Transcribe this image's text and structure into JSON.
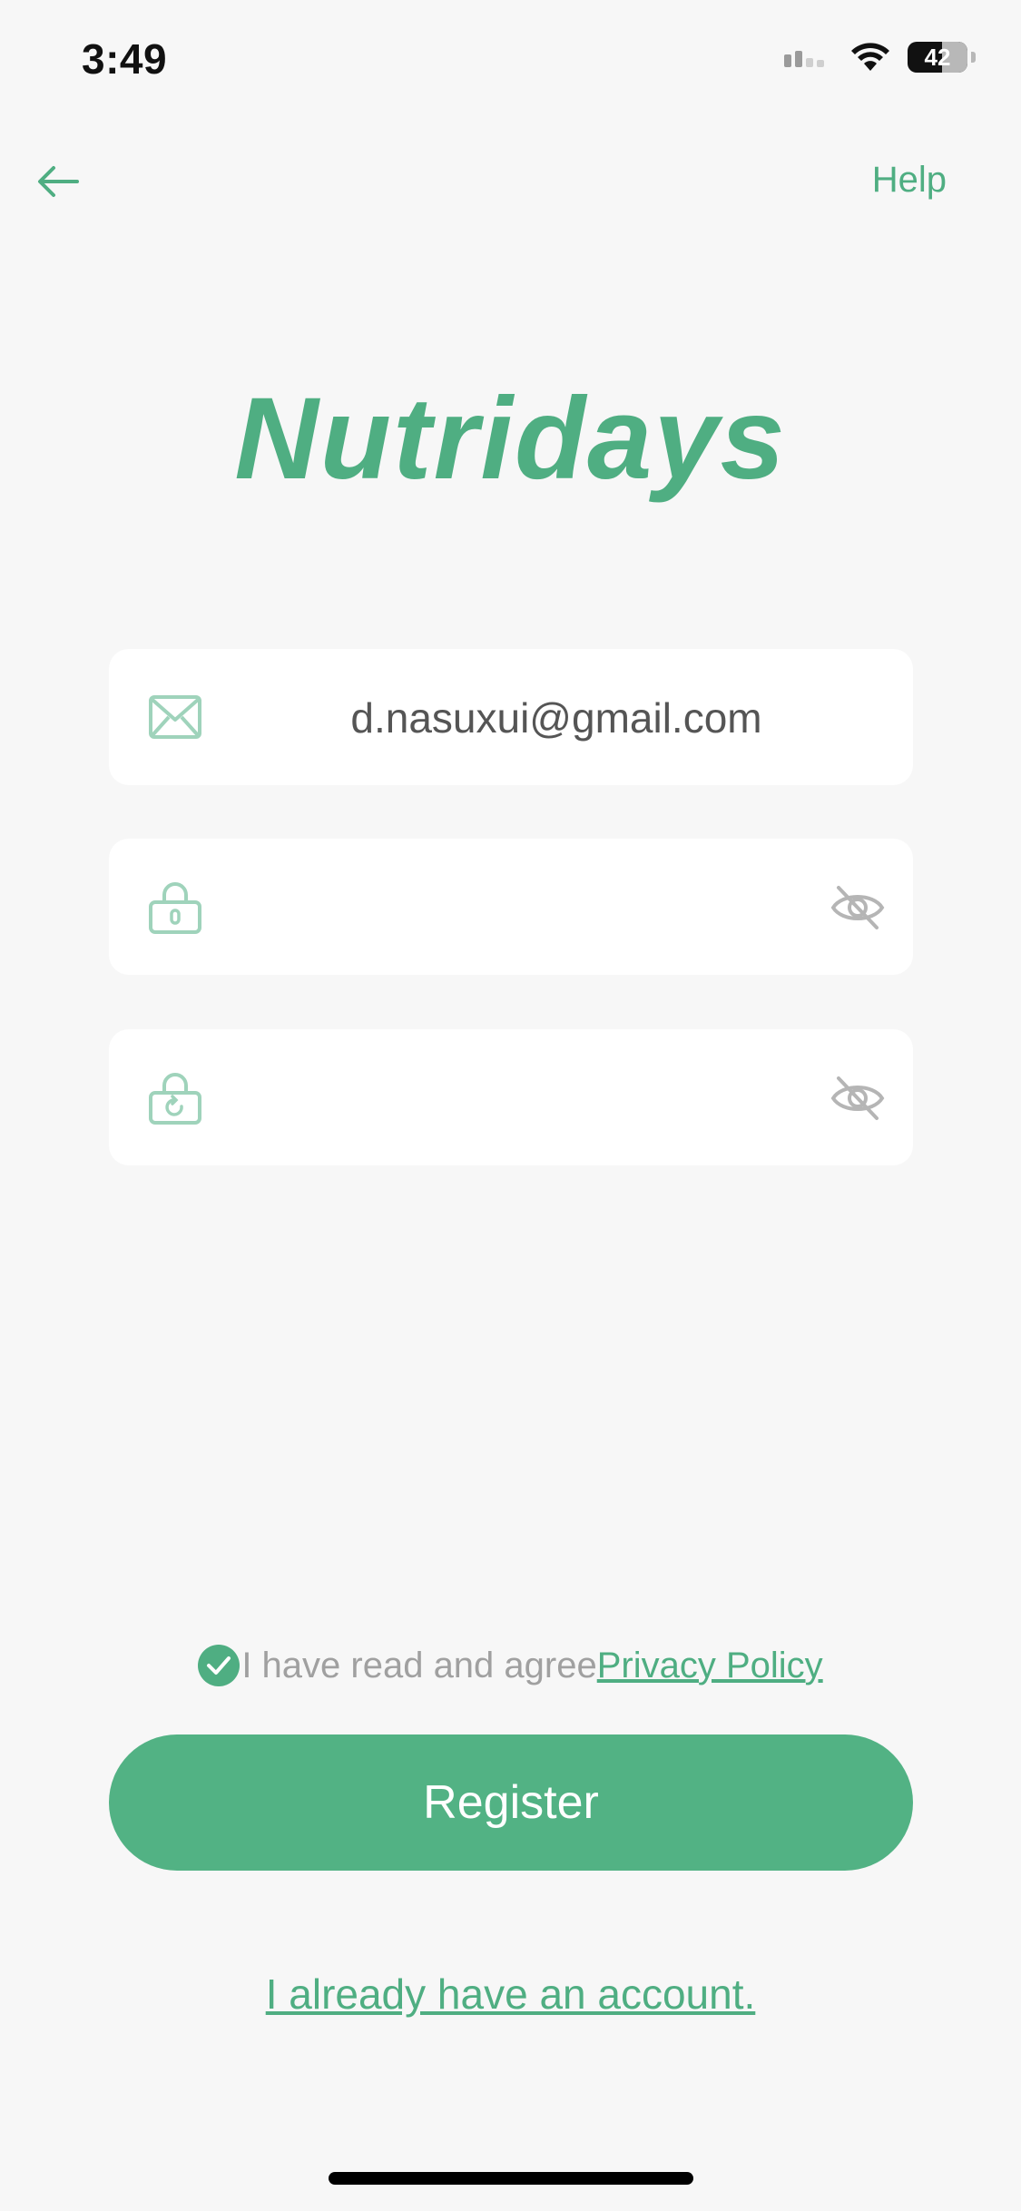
{
  "status_bar": {
    "time": "3:49",
    "battery_level": "42"
  },
  "nav": {
    "back_icon": "arrow-left-icon",
    "help_label": "Help"
  },
  "brand": {
    "logo_text": "Nutridays"
  },
  "form": {
    "email": {
      "icon": "envelope-icon",
      "value": "d.nasuxui@gmail.com"
    },
    "password": {
      "icon": "lock-icon",
      "value": "",
      "toggle_icon": "eye-off-icon"
    },
    "confirm_password": {
      "icon": "lock-refresh-icon",
      "value": "",
      "toggle_icon": "eye-off-icon"
    }
  },
  "agreement": {
    "checked": true,
    "text": "I have read and agree",
    "link_label": "Privacy Policy"
  },
  "actions": {
    "register_label": "Register",
    "login_link_label": "I already have an account."
  },
  "colors": {
    "accent": "#4fae82",
    "button": "#52b284",
    "background": "#f7f7f7"
  }
}
